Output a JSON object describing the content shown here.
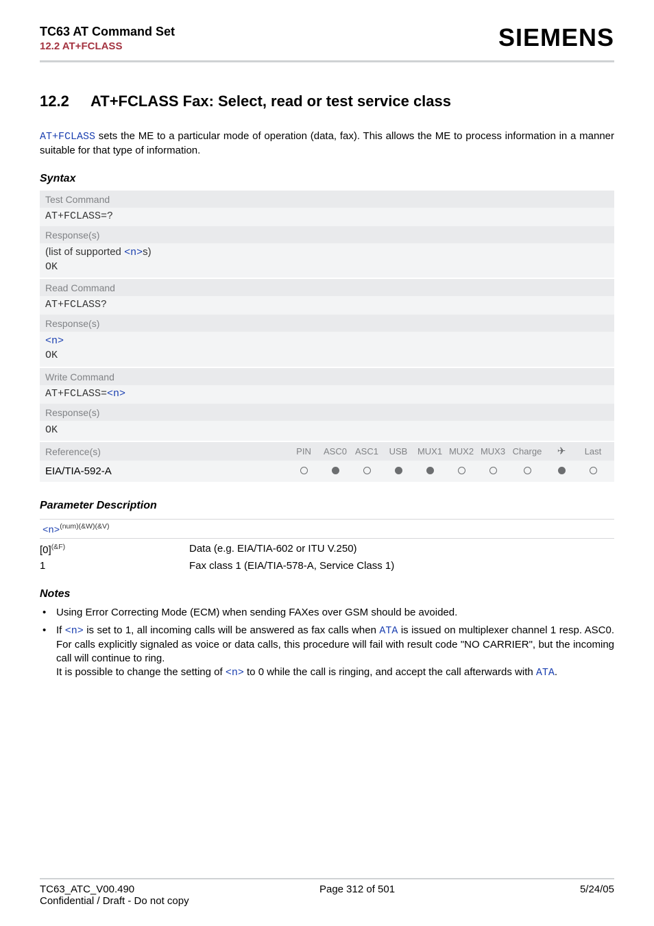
{
  "header": {
    "title": "TC63 AT Command Set",
    "subtitle": "12.2 AT+FCLASS",
    "logo": "SIEMENS"
  },
  "section": {
    "number": "12.2",
    "title": "AT+FCLASS   Fax: Select, read or test service class"
  },
  "intro": {
    "cmd": "AT+FCLASS",
    "text_after": " sets the ME to a particular mode of operation (data, fax). This allows the ME to process information in a manner suitable for that type of information."
  },
  "syntax_label": "Syntax",
  "syntax": {
    "test": {
      "h": "Test Command",
      "cmd": "AT+FCLASS=?",
      "rh": "Response(s)",
      "resp_pre": "(list of supported ",
      "resp_n": "<n>",
      "resp_post": "s)",
      "ok": "OK"
    },
    "read": {
      "h": "Read Command",
      "cmd": "AT+FCLASS?",
      "rh": "Response(s)",
      "resp_n": "<n>",
      "ok": "OK"
    },
    "write": {
      "h": "Write Command",
      "cmd_pre": "AT+FCLASS=",
      "cmd_n": "<n>",
      "rh": "Response(s)",
      "ok": "OK"
    },
    "ref": {
      "h": "Reference(s)",
      "cols": [
        "PIN",
        "ASC0",
        "ASC1",
        "USB",
        "MUX1",
        "MUX2",
        "MUX3",
        "Charge",
        "plane",
        "Last"
      ],
      "value": "EIA/TIA-592-A",
      "dots": [
        "o",
        "f",
        "o",
        "f",
        "f",
        "o",
        "o",
        "o",
        "f",
        "o"
      ]
    }
  },
  "paramdesc_label": "Parameter Description",
  "param": {
    "tag": "<n>",
    "tag_sup": "(num)(&W)(&V)",
    "rows": [
      {
        "k_pre": "[0]",
        "k_sup": "(&F)",
        "v": "Data (e.g. EIA/TIA-602 or ITU V.250)"
      },
      {
        "k_pre": "1",
        "k_sup": "",
        "v": "Fax class 1 (EIA/TIA-578-A, Service Class 1)"
      }
    ]
  },
  "notes_label": "Notes",
  "notes": {
    "n1": "Using Error Correcting Mode (ECM) when sending FAXes over GSM should be avoided.",
    "n2_a": "If ",
    "n2_n1": "<n>",
    "n2_b": " is set to 1, all incoming calls will be answered as fax calls when ",
    "n2_ata1": "ATA",
    "n2_c": " is issued on multiplexer channel 1 resp. ASC0. For calls explicitly signaled as voice or data calls, this procedure will fail with result code \"NO CARRIER\", but the incoming call will continue to ring.",
    "n2_d": "It is possible to change the setting of ",
    "n2_n2": "<n>",
    "n2_e": " to 0 while the call is ringing, and accept the call afterwards with ",
    "n2_ata2": "ATA",
    "n2_f": "."
  },
  "footer": {
    "left1": "TC63_ATC_V00.490",
    "left2": "Confidential / Draft - Do not copy",
    "center": "Page 312 of 501",
    "right": "5/24/05"
  }
}
